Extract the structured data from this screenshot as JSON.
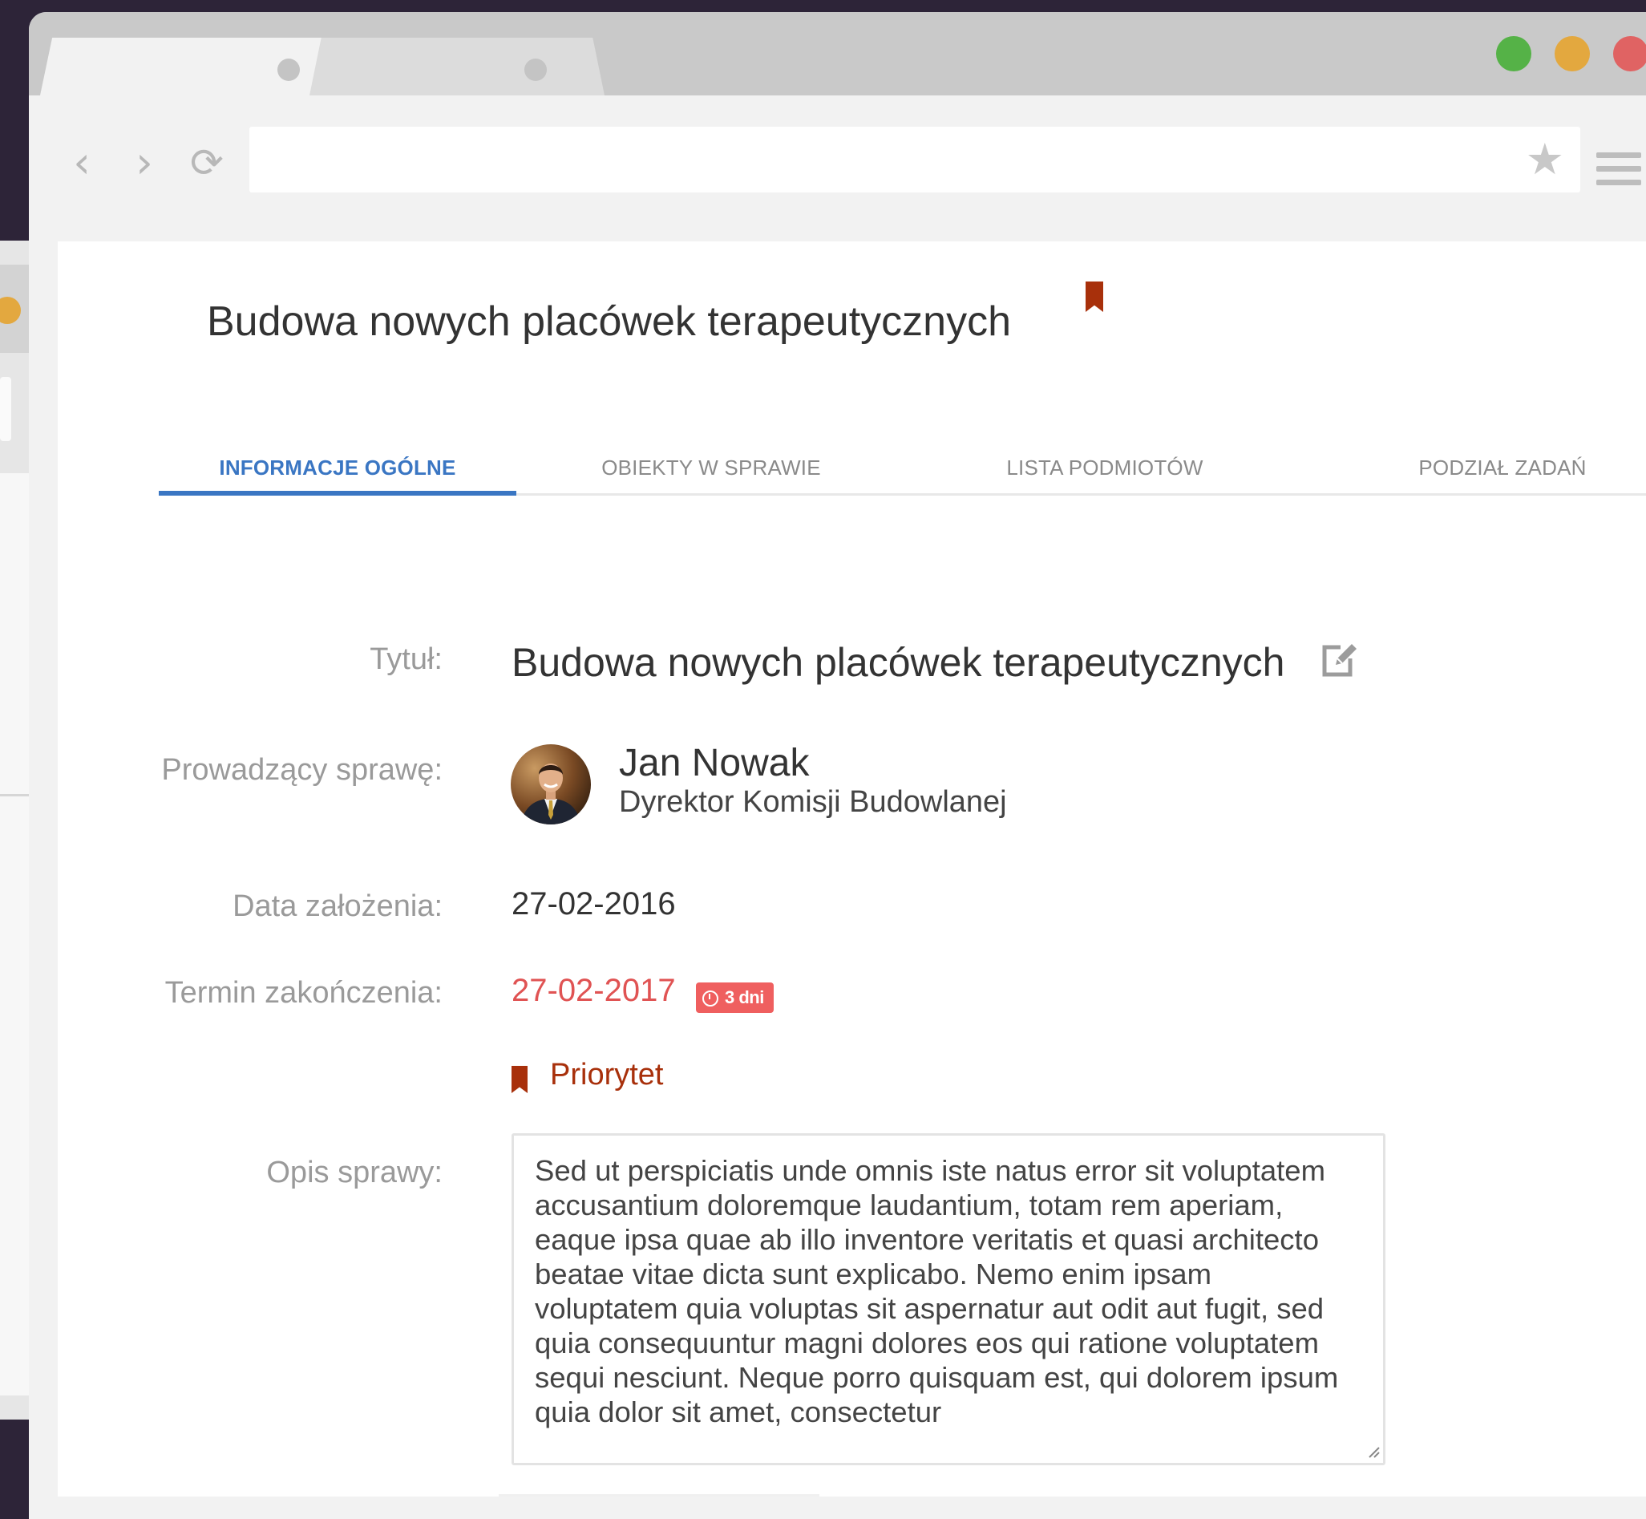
{
  "browser": {
    "tabs": [
      {
        "state": "active"
      },
      {
        "state": "inactive"
      }
    ],
    "window_controls": {
      "colors": [
        "#55b247",
        "#e3a83f",
        "#e06363"
      ]
    },
    "icons": {
      "back": "chevron-left-icon",
      "forward": "chevron-right-icon",
      "reload": "reload-icon",
      "bookmark_star": "star-icon",
      "menu": "hamburger-menu-icon"
    },
    "address_bar": {
      "value": ""
    }
  },
  "page": {
    "title": "Budowa nowych placówek terapeutycznych",
    "tabs": [
      {
        "label": "INFORMACJE OGÓLNE",
        "active": true
      },
      {
        "label": "OBIEKTY W SPRAWIE",
        "active": false
      },
      {
        "label": "LISTA PODMIOTÓW",
        "active": false
      },
      {
        "label": "PODZIAŁ ZADAŃ",
        "active": false
      }
    ],
    "fields": {
      "title_label": "Tytuł:",
      "title_value": "Budowa nowych placówek terapeutycznych",
      "owner_label": "Prowadzący sprawę:",
      "owner_name": "Jan Nowak",
      "owner_role": "Dyrektor Komisji Budowlanej",
      "created_label": "Data założenia:",
      "created_value": "27-02-2016",
      "deadline_label": "Termin zakończenia:",
      "deadline_value": "27-02-2017",
      "deadline_badge": "3 dni",
      "priority_label": "Priorytet",
      "description_label": "Opis sprawy:",
      "description_value": "Sed ut perspiciatis unde omnis iste natus error sit voluptatem accusantium doloremque laudantium, totam rem aperiam, eaque ipsa quae ab illo inventore veritatis et quasi architecto beatae vitae dicta sunt explicabo. Nemo enim ipsam voluptatem quia voluptas sit aspernatur aut odit aut fugit, sed quia consequuntur magni dolores eos qui ratione voluptatem sequi nesciunt. Neque porro quisquam est, qui dolorem ipsum quia dolor sit amet, consectetur"
    },
    "colors": {
      "accent_blue": "#3a76c3",
      "deadline_red": "#e05353",
      "badge_red": "#ef5f5f",
      "priority_brown": "#a8300b"
    }
  }
}
